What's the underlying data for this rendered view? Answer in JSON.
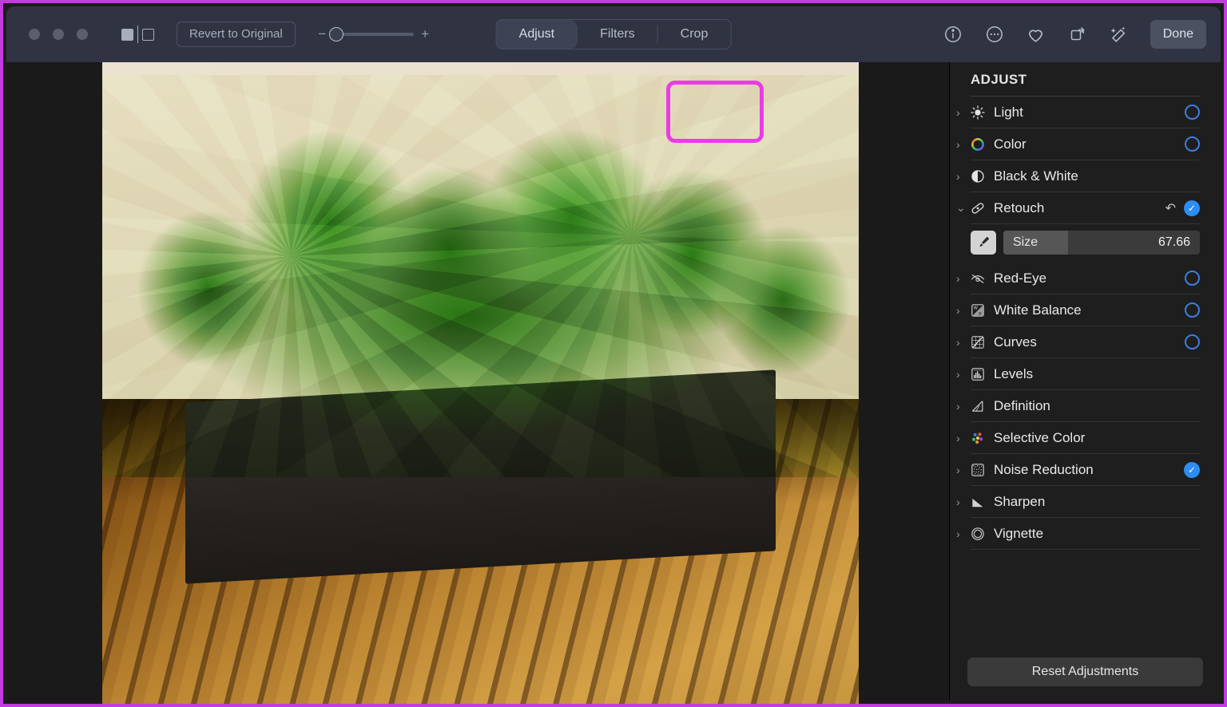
{
  "window": {
    "traffic_lights": [
      "close",
      "minimize",
      "zoom"
    ],
    "split_view_icon": "split-view-icon"
  },
  "toolbar": {
    "revert_label": "Revert to Original",
    "zoom_minus": "−",
    "zoom_plus": "+",
    "zoom_level": 0,
    "tabs": [
      {
        "label": "Adjust",
        "active": true
      },
      {
        "label": "Filters",
        "active": false
      },
      {
        "label": "Crop",
        "active": false
      }
    ],
    "tools": [
      {
        "name": "info-icon",
        "glyph": "ⓘ"
      },
      {
        "name": "more-options-icon",
        "glyph": "⋯"
      },
      {
        "name": "favorite-heart-icon",
        "glyph": "♡"
      },
      {
        "name": "rotate-icon",
        "glyph": "↻"
      },
      {
        "name": "auto-enhance-icon",
        "glyph": "✦"
      }
    ],
    "done_label": "Done"
  },
  "sidebar": {
    "title": "ADJUST",
    "items": [
      {
        "label": "Light",
        "icon": "sun-icon",
        "expanded": false,
        "toggle": "ring"
      },
      {
        "label": "Color",
        "icon": "color-wheel-icon",
        "expanded": false,
        "toggle": "ring"
      },
      {
        "label": "Black & White",
        "icon": "half-circle-icon",
        "expanded": false,
        "toggle": "none"
      },
      {
        "label": "Retouch",
        "icon": "bandage-icon",
        "expanded": true,
        "toggle": "check",
        "has_undo": true
      },
      {
        "label": "Red-Eye",
        "icon": "eye-slash-icon",
        "expanded": false,
        "toggle": "ring"
      },
      {
        "label": "White Balance",
        "icon": "white-balance-icon",
        "expanded": false,
        "toggle": "ring"
      },
      {
        "label": "Curves",
        "icon": "curves-icon",
        "expanded": false,
        "toggle": "ring"
      },
      {
        "label": "Levels",
        "icon": "levels-icon",
        "expanded": false,
        "toggle": "none"
      },
      {
        "label": "Definition",
        "icon": "definition-icon",
        "expanded": false,
        "toggle": "none"
      },
      {
        "label": "Selective Color",
        "icon": "selective-color-icon",
        "expanded": false,
        "toggle": "none"
      },
      {
        "label": "Noise Reduction",
        "icon": "noise-reduction-icon",
        "expanded": false,
        "toggle": "check"
      },
      {
        "label": "Sharpen",
        "icon": "sharpen-icon",
        "expanded": false,
        "toggle": "none"
      },
      {
        "label": "Vignette",
        "icon": "vignette-icon",
        "expanded": false,
        "toggle": "none"
      }
    ],
    "retouch": {
      "brush_icon": "brush-icon",
      "size_label": "Size",
      "size_value": "67.66",
      "size_fill_percent": 33
    },
    "reset_label": "Reset Adjustments"
  },
  "photo": {
    "subject": "preserved green moss in a dark rectangular planter on a wooden table",
    "annotation": {
      "shape": "rounded-rectangle",
      "color": "#ea3ce6"
    }
  },
  "colors": {
    "accent_blue": "#2d8cf5",
    "annotation_magenta": "#ea3ce6",
    "toolbar_bg": "#2f3342",
    "sidebar_bg": "#1e1e1e",
    "canvas_bg": "#1a1a1a"
  }
}
